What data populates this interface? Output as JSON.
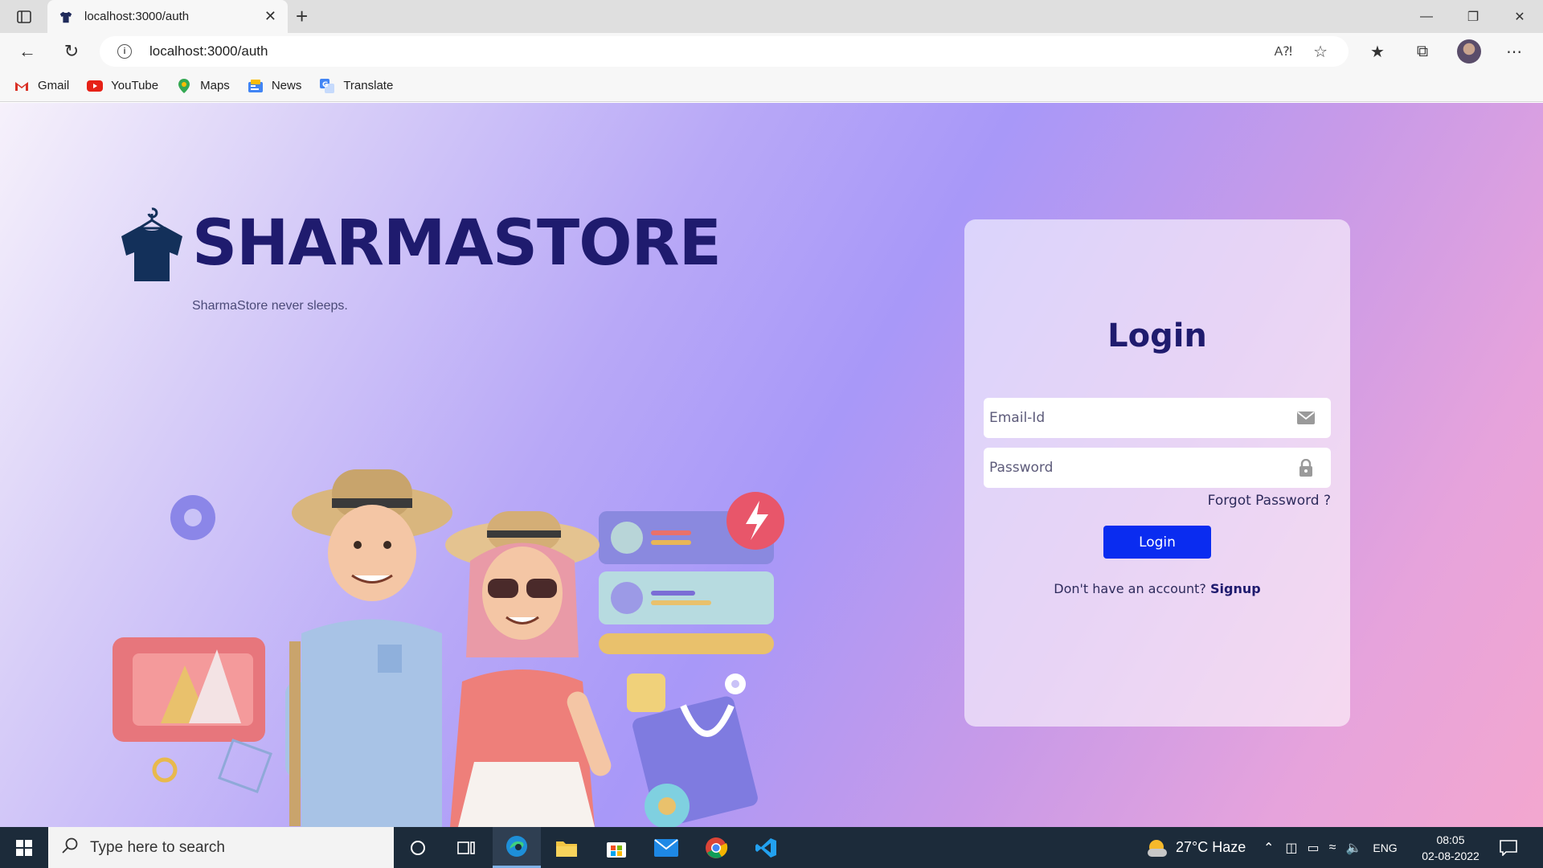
{
  "browser": {
    "tab_title": "localhost:3000/auth",
    "tab_close": "✕",
    "new_tab": "+",
    "url": "localhost:3000/auth",
    "bookmarks": [
      {
        "label": "Gmail"
      },
      {
        "label": "YouTube"
      },
      {
        "label": "Maps"
      },
      {
        "label": "News"
      },
      {
        "label": "Translate"
      }
    ]
  },
  "page": {
    "brand": "SHARMASTORE",
    "tagline": "SharmaStore never sleeps.",
    "login": {
      "title": "Login",
      "email_placeholder": "Email-Id",
      "password_placeholder": "Password",
      "forgot": "Forgot Password ?",
      "button": "Login",
      "no_account": "Don't have an account?",
      "signup": "Signup"
    }
  },
  "taskbar": {
    "search_placeholder": "Type here to search",
    "weather": "27°C  Haze",
    "language": "ENG",
    "time": "08:05",
    "date": "02-08-2022"
  },
  "colors": {
    "brand": "#1f1b6e",
    "button": "#0a2cf0"
  }
}
